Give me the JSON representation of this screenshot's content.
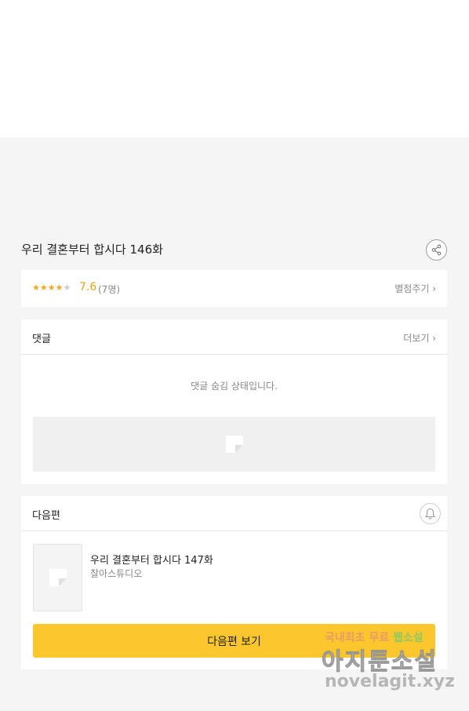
{
  "episode": {
    "title": "우리 결혼부터 합시다 146화"
  },
  "rating": {
    "stars_filled": 4,
    "stars_total": 5,
    "score": "7.6",
    "count": "(7명)",
    "rate_link": "별점주기 ›"
  },
  "comments": {
    "header": "댓글",
    "more_link": "더보기 ›",
    "hidden_note": "댓글 숨김 상태입니다."
  },
  "next_episode": {
    "header": "다음편",
    "title": "우리 결혼부터 합시다 147화",
    "author": "찰아스튜디오",
    "button_label": "다음편 보기"
  },
  "watermark": {
    "line1_prefix": "국내최초 무료 ",
    "line1_highlight": "웹소설",
    "line2": "아지툰소설",
    "line3": "novelagit.xyz"
  },
  "colors": {
    "accent_yellow": "#fcc72c",
    "star_orange": "#f5a623",
    "score_orange": "#e8a317"
  },
  "icons": [
    "share-icon",
    "star-icon",
    "chevron-right-icon",
    "image-placeholder-icon",
    "bell-icon"
  ]
}
